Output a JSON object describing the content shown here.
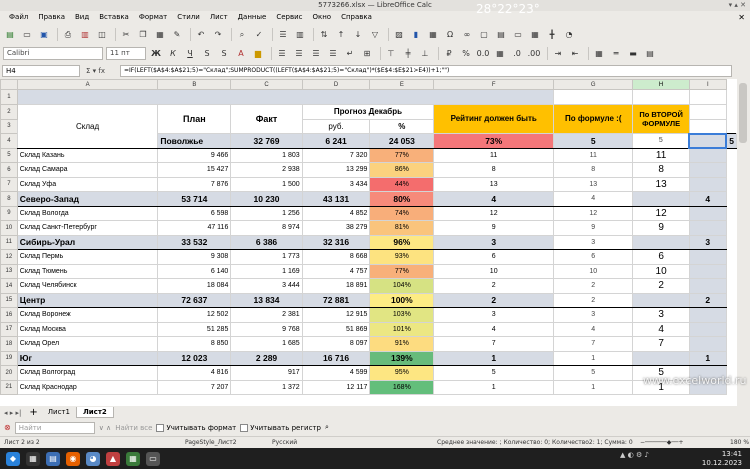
{
  "window": {
    "title": "5773266.xlsx — LibreOffice Calc"
  },
  "menu": [
    "Файл",
    "Правка",
    "Вид",
    "Вставка",
    "Формат",
    "Стили",
    "Лист",
    "Данные",
    "Сервис",
    "Окно",
    "Справка"
  ],
  "toolbar": {
    "font_name": "Calibri",
    "font_size": "11 пт"
  },
  "formula_bar": {
    "cell_ref": "H4",
    "formula": "=IF(LEFT($A$4:$A$21;5)=\"Склад\";SUMPRODUCT((LEFT($A$4:$A$21;5)=\"Склад\")*($E$4:$E$21>E4))+1;\"\")"
  },
  "columns": [
    "A",
    "B",
    "C",
    "D",
    "E",
    "F",
    "G",
    "H",
    "I"
  ],
  "headers": {
    "sklad": "Склад",
    "plan": "План",
    "fact": "Факт",
    "forecast": "Прогноз Декабрь",
    "rub": "руб.",
    "pct": "%",
    "rating": "Рейтинг должен быть",
    "by_formula": "По формуле :(",
    "second_formula": "По ВТОРОЙ ФОРМУЛЕ"
  },
  "rows": [
    {
      "n": "4",
      "name": "Поволжье",
      "plan": "32 769",
      "fact": "6 241",
      "rub": "24 053",
      "pct": "73%",
      "rating": "5",
      "g": "5",
      "h": "",
      "i": "5",
      "region": true,
      "color": "#f4777a"
    },
    {
      "n": "5",
      "name": "Склад Казань",
      "plan": "9 466",
      "fact": "1 803",
      "rub": "7 320",
      "pct": "77%",
      "rating": "11",
      "g": "11",
      "h": "11",
      "i": "",
      "region": false,
      "color": "#f8b07a"
    },
    {
      "n": "6",
      "name": "Склад Самара",
      "plan": "15 427",
      "fact": "2 938",
      "rub": "13 299",
      "pct": "86%",
      "rating": "8",
      "g": "8",
      "h": "8",
      "i": "",
      "region": false,
      "color": "#fbd27e"
    },
    {
      "n": "7",
      "name": "Склад Уфа",
      "plan": "7 876",
      "fact": "1 500",
      "rub": "3 434",
      "pct": "44%",
      "rating": "13",
      "g": "13",
      "h": "13",
      "i": "",
      "region": false,
      "color": "#f46d6d"
    },
    {
      "n": "8",
      "name": "Северо-Запад",
      "plan": "53 714",
      "fact": "10 230",
      "rub": "43 131",
      "pct": "80%",
      "rating": "4",
      "g": "4",
      "h": "",
      "i": "4",
      "region": true,
      "color": "#f68a7a"
    },
    {
      "n": "9",
      "name": "Склад Вологда",
      "plan": "6 598",
      "fact": "1 256",
      "rub": "4 852",
      "pct": "74%",
      "rating": "12",
      "g": "12",
      "h": "12",
      "i": "",
      "region": false,
      "color": "#f8ae7a"
    },
    {
      "n": "10",
      "name": "Склад Санкт-Петербург",
      "plan": "47 116",
      "fact": "8 974",
      "rub": "38 279",
      "pct": "81%",
      "rating": "9",
      "g": "9",
      "h": "9",
      "i": "",
      "region": false,
      "color": "#fac47c"
    },
    {
      "n": "11",
      "name": "Сибирь-Урал",
      "plan": "33 532",
      "fact": "6 386",
      "rub": "32 316",
      "pct": "96%",
      "rating": "3",
      "g": "3",
      "h": "",
      "i": "3",
      "region": true,
      "color": "#fde883"
    },
    {
      "n": "12",
      "name": "Склад Пермь",
      "plan": "9 308",
      "fact": "1 773",
      "rub": "8 668",
      "pct": "93%",
      "rating": "6",
      "g": "6",
      "h": "6",
      "i": "",
      "region": false,
      "color": "#fde380"
    },
    {
      "n": "13",
      "name": "Склад Тюмень",
      "plan": "6 140",
      "fact": "1 169",
      "rub": "4 757",
      "pct": "77%",
      "rating": "10",
      "g": "10",
      "h": "10",
      "i": "",
      "region": false,
      "color": "#f8b07a"
    },
    {
      "n": "14",
      "name": "Склад Челябинск",
      "plan": "18 084",
      "fact": "3 444",
      "rub": "18 891",
      "pct": "104%",
      "rating": "2",
      "g": "2",
      "h": "2",
      "i": "",
      "region": false,
      "color": "#d6e283"
    },
    {
      "n": "15",
      "name": "Центр",
      "plan": "72 637",
      "fact": "13 834",
      "rub": "72 881",
      "pct": "100%",
      "rating": "2",
      "g": "2",
      "h": "",
      "i": "2",
      "region": true,
      "color": "#fdec84"
    },
    {
      "n": "16",
      "name": "Склад Воронеж",
      "plan": "12 502",
      "fact": "2 381",
      "rub": "12 915",
      "pct": "103%",
      "rating": "3",
      "g": "3",
      "h": "3",
      "i": "",
      "region": false,
      "color": "#e1e583"
    },
    {
      "n": "17",
      "name": "Склад Москва",
      "plan": "51 285",
      "fact": "9 768",
      "rub": "51 869",
      "pct": "101%",
      "rating": "4",
      "g": "4",
      "h": "4",
      "i": "",
      "region": false,
      "color": "#ece783"
    },
    {
      "n": "18",
      "name": "Склад Орел",
      "plan": "8 850",
      "fact": "1 685",
      "rub": "8 097",
      "pct": "91%",
      "rating": "7",
      "g": "7",
      "h": "7",
      "i": "",
      "region": false,
      "color": "#fddc80"
    },
    {
      "n": "19",
      "name": "Юг",
      "plan": "12 023",
      "fact": "2 289",
      "rub": "16 716",
      "pct": "139%",
      "rating": "1",
      "g": "1",
      "h": "",
      "i": "1",
      "region": true,
      "color": "#67bb7b"
    },
    {
      "n": "20",
      "name": "Склад Волгоград",
      "plan": "4 816",
      "fact": "917",
      "rub": "4 599",
      "pct": "95%",
      "rating": "5",
      "g": "5",
      "h": "5",
      "i": "",
      "region": false,
      "color": "#fde682"
    },
    {
      "n": "21",
      "name": "Склад Краснодар",
      "plan": "7 207",
      "fact": "1 372",
      "rub": "12 117",
      "pct": "168%",
      "rating": "1",
      "g": "1",
      "h": "1",
      "i": "",
      "region": false,
      "color": "#63be7b"
    }
  ],
  "sheets": [
    "Лист1",
    "Лист2"
  ],
  "find": {
    "placeholder": "Найти",
    "find_all": "Найти все",
    "match_format": "Учитывать формат",
    "match_case": "Учитывать регистр"
  },
  "status": {
    "sheet": "Лист 2 из 2",
    "pagestyle": "PageStyle_Лист2",
    "lang": "Русский",
    "summary": "Среднее значение: ; Количество: 0; Количество2: 1; Сумма: 0",
    "zoom": "180 %"
  },
  "taskbar": {
    "temp": "28°22°23°",
    "time": "13:41",
    "date": "10.12.2023"
  },
  "watermark": "www.excelworld.ru"
}
